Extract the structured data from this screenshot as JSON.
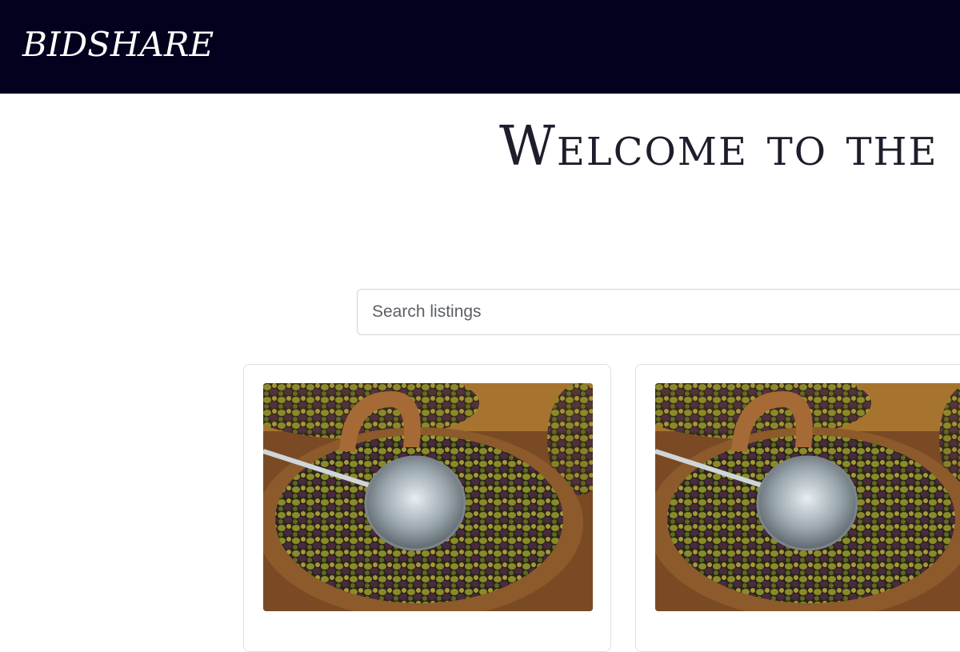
{
  "navbar": {
    "brand": "BIDSHARE",
    "background": "#02021f"
  },
  "main": {
    "heading": "Welcome to the Bi"
  },
  "search": {
    "placeholder": "Search listings",
    "value": ""
  },
  "listings": [
    {
      "image_icon": "olives-photo"
    },
    {
      "image_icon": "olives-photo"
    }
  ]
}
